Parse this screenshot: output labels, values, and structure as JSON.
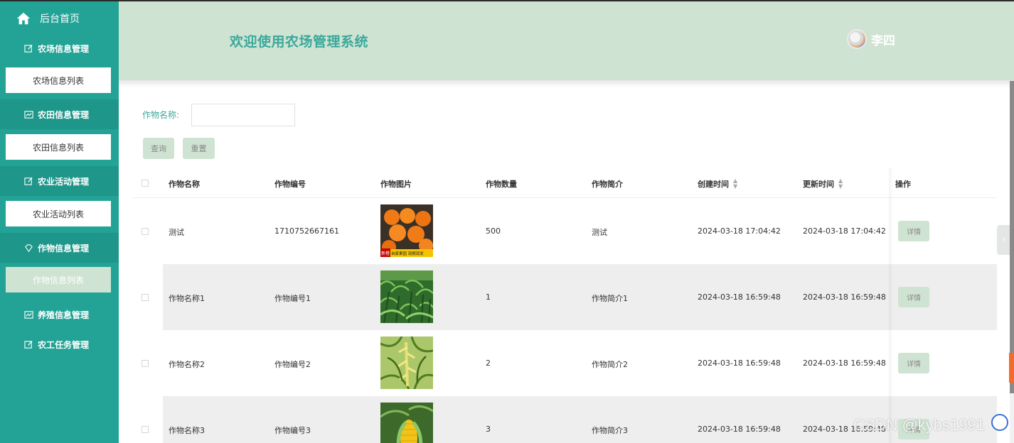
{
  "sidebar": {
    "home_label": "后台首页",
    "menus": [
      {
        "label": "农场信息管理",
        "icon": "edit-icon",
        "sub": "农场信息列表"
      },
      {
        "label": "农田信息管理",
        "icon": "chart-icon",
        "sub": "农田信息列表"
      },
      {
        "label": "农业活动管理",
        "icon": "edit-icon",
        "sub": "农业活动列表"
      },
      {
        "label": "作物信息管理",
        "icon": "diamond-icon",
        "sub": "作物信息列表"
      },
      {
        "label": "养殖信息管理",
        "icon": "chart-icon"
      },
      {
        "label": "农工任务管理",
        "icon": "edit-icon"
      }
    ],
    "active_sub": "作物信息列表"
  },
  "header": {
    "title": "欢迎使用农场管理系统",
    "username": "李四"
  },
  "search": {
    "label": "作物名称:",
    "value": "",
    "query_button": "查询",
    "reset_button": "重置"
  },
  "table": {
    "columns": [
      "作物名称",
      "作物编号",
      "作物图片",
      "作物数量",
      "作物简介",
      "创建时间",
      "更新时间",
      "操作"
    ],
    "rows": [
      {
        "name": "测试",
        "code": "1710752667161",
        "image": "oranges",
        "qty": "500",
        "intro": "测试",
        "created": "2024-03-18 17:04:42",
        "updated": "2024-03-18 17:04:42",
        "action": "详情"
      },
      {
        "name": "作物名称1",
        "code": "作物编号1",
        "image": "cornfield",
        "qty": "1",
        "intro": "作物简介1",
        "created": "2024-03-18 16:59:48",
        "updated": "2024-03-18 16:59:48",
        "action": "详情"
      },
      {
        "name": "作物名称2",
        "code": "作物编号2",
        "image": "corn-tassel",
        "qty": "2",
        "intro": "作物简介2",
        "created": "2024-03-18 16:59:48",
        "updated": "2024-03-18 16:59:48",
        "action": "详情"
      },
      {
        "name": "作物名称3",
        "code": "作物编号3",
        "image": "corn-cob",
        "qty": "3",
        "intro": "作物简介3",
        "created": "2024-03-18 16:59:48",
        "updated": "2024-03-18 16:59:48",
        "action": "详情"
      }
    ]
  },
  "image_text": {
    "oranges_tag": "自家果园 现摘现发",
    "oranges_side": "新橙"
  },
  "watermark": "CSDN @kybs1991",
  "colors": {
    "sidebar": "#22a396",
    "header_bg": "#cfe3d2",
    "accent_text": "#3aa89a"
  }
}
